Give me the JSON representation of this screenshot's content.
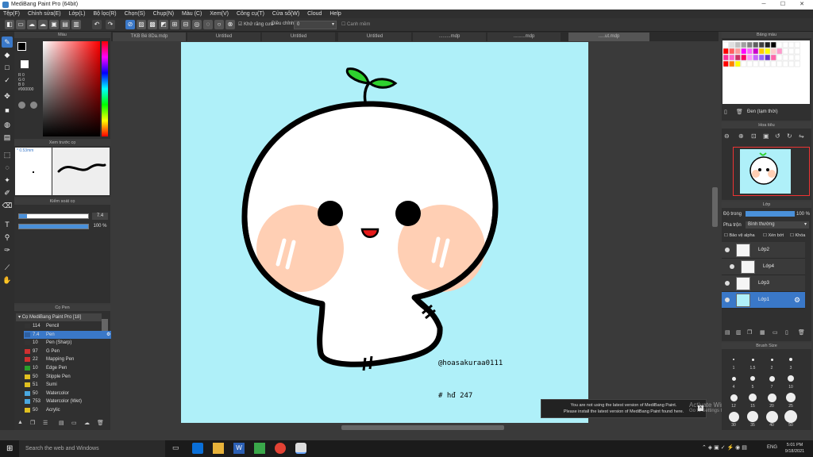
{
  "window": {
    "title": "MediBang Paint Pro (64bit)"
  },
  "menu": [
    "Tệp(F)",
    "Chỉnh sửa(E)",
    "Lớp(L)",
    "Bộ lọc(R)",
    "Chọn(S)",
    "Chụp(N)",
    "Màu (C)",
    "Xem(V)",
    "Công cụ(T)",
    "Cửa sổ(W)",
    "Cloud",
    "Help"
  ],
  "toolbar": {
    "antialias_label": "Khử răng cưa",
    "correction_label": "Điều chỉnh",
    "correction_value": "0",
    "snap_label": "Canh mềm"
  },
  "tabs": [
    "TKB Bé 8Da.mdp",
    "Untitled",
    "Untitled",
    "Untitled",
    ".........mdp",
    ".........mdp",
    ".....ut.mdp"
  ],
  "color_panel": {
    "title": "Màu",
    "r": "R 0",
    "g": "G 0",
    "b": "B 0",
    "hex": "#000000"
  },
  "brush_preview": {
    "title": "Xem trước cọ",
    "size": "0.53mm"
  },
  "brush_control": {
    "title": "Kiểm soát cọ",
    "size": "7.4",
    "opacity": "100 %"
  },
  "brush_panel": {
    "title": "Cọ Pen",
    "group": "Cọ MediBang Paint Pro [18]",
    "items": [
      {
        "size": "114",
        "name": "Pencil",
        "color": "#333333"
      },
      {
        "size": "7.4",
        "name": "Pen",
        "color": "#2e5fa0"
      },
      {
        "size": "10",
        "name": "Pen (Sharp)",
        "color": "#333333"
      },
      {
        "size": "97",
        "name": "G Pen",
        "color": "#d03030"
      },
      {
        "size": "22",
        "name": "Mapping Pen",
        "color": "#d03030"
      },
      {
        "size": "10",
        "name": "Edge Pen",
        "color": "#2aa02a"
      },
      {
        "size": "50",
        "name": "Stipple Pen",
        "color": "#e0c020"
      },
      {
        "size": "51",
        "name": "Sumi",
        "color": "#e0c020"
      },
      {
        "size": "50",
        "name": "Watercolor",
        "color": "#4aa8e0"
      },
      {
        "size": "753",
        "name": "Watercolor (Wet)",
        "color": "#4aa8e0"
      },
      {
        "size": "50",
        "name": "Acrylic",
        "color": "#e0c020"
      }
    ]
  },
  "palette_panel": {
    "title": "Bảng màu",
    "footer": "Đen (tạm thời)"
  },
  "navigator_panel": {
    "title": "Hoa tiêu"
  },
  "layer_panel": {
    "title": "Lớp",
    "opacity_label": "Độ trong",
    "opacity_value": "100 %",
    "blend_label": "Pha trộn",
    "blend_value": "Bình thường",
    "protect_alpha": "Bảo vệ alpha",
    "clipping": "Xén bớt",
    "lock": "Khóa",
    "layers": [
      "Lớp2",
      "Lớp4",
      "Lớp3",
      "Lớp1"
    ]
  },
  "brush_size_panel": {
    "title": "Brush Size",
    "labels": [
      "1",
      "1.5",
      "2",
      "3",
      "4",
      "5",
      "7",
      "10",
      "12",
      "15",
      "20",
      "25",
      "30",
      "35",
      "40",
      "50"
    ]
  },
  "canvas": {
    "signature": "@hoasakuraa0111",
    "hashtag": "# hđ 247",
    "bg_color": "#aff0f9"
  },
  "notice": {
    "line1": "You are not using the latest version of MediBang Paint.",
    "line2": "Please install the latest version of MediBang Paint found here."
  },
  "watermark": {
    "line1": "Activate Windows",
    "line2": "Go to Settings to activate Windows."
  },
  "taskbar": {
    "search_placeholder": "Search the web and Windows",
    "lang": "ENG",
    "time": "5:01 PM",
    "date": "9/18/2021"
  }
}
